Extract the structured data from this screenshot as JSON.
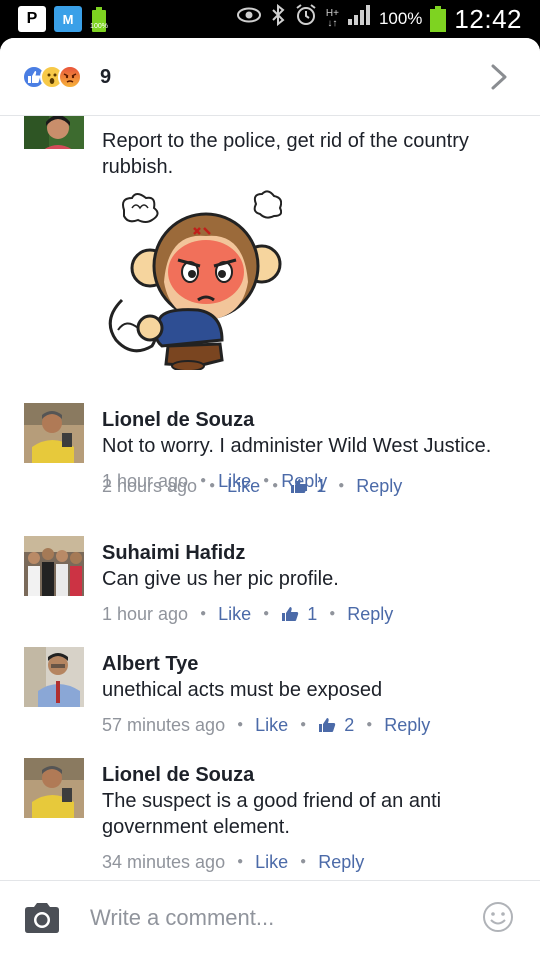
{
  "status_bar": {
    "app_icon_1": "P",
    "app_icon_2": "M",
    "small_battery_label": "100%",
    "network_label_top": "H+",
    "network_label_bottom": "↓↑",
    "battery_percent": "100%",
    "time": "12:42"
  },
  "reactions": {
    "count": "9",
    "icons": [
      "like-reaction",
      "wow-reaction",
      "angry-reaction"
    ]
  },
  "comments": [
    {
      "id": "c0",
      "text": "Report to the police, get rid of the country rubbish.",
      "has_sticker": true,
      "time": "2 hours ago",
      "like_label": "Like",
      "likes": "1",
      "reply_label": "Reply"
    },
    {
      "id": "c1",
      "name": "Lionel de Souza",
      "text": "Not to worry.  I administer Wild West Justice.",
      "time": "1 hour ago",
      "like_label": "Like",
      "reply_label": "Reply"
    },
    {
      "id": "c2",
      "name": "Suhaimi Hafidz",
      "text": "Can give us her pic profile.",
      "time": "1 hour ago",
      "like_label": "Like",
      "likes": "1",
      "reply_label": "Reply"
    },
    {
      "id": "c3",
      "name": "Albert Tye",
      "text": "unethical acts must be exposed",
      "time": "57 minutes ago",
      "like_label": "Like",
      "likes": "2",
      "reply_label": "Reply"
    },
    {
      "id": "c4",
      "name": "Lionel de Souza",
      "text": "The suspect is a good friend of an anti government element.",
      "time": "34 minutes ago",
      "like_label": "Like",
      "reply_label": "Reply"
    }
  ],
  "composer": {
    "placeholder": "Write a comment..."
  },
  "colors": {
    "link": "#4b6aa8",
    "meta": "#90949c",
    "text": "#1d2129",
    "like_blue": "#4a7ee3"
  }
}
